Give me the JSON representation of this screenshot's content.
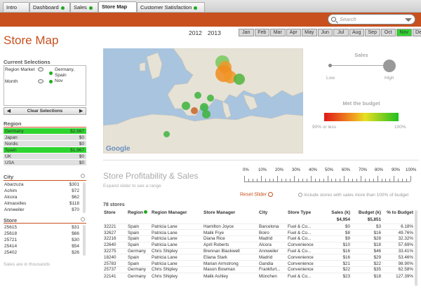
{
  "tabs": [
    {
      "label": "Intro",
      "dot": false,
      "active": false
    },
    {
      "label": "Dashboard",
      "dot": true,
      "active": false
    },
    {
      "label": "Sales",
      "dot": true,
      "active": false
    },
    {
      "label": "Store Map",
      "dot": false,
      "active": true
    },
    {
      "label": "Customer Satisfaction",
      "dot": true,
      "active": false
    }
  ],
  "search": {
    "placeholder": "Search"
  },
  "page_title": "Store Map",
  "years": [
    "2012",
    "2013"
  ],
  "months": [
    "Jan",
    "Feb",
    "Mar",
    "Apr",
    "May",
    "Jun",
    "Jul",
    "Aug",
    "Sep",
    "Oct",
    "Nov",
    "Dec"
  ],
  "selected_month": "Nov",
  "current_selections": {
    "title": "Current Selections",
    "rows": [
      {
        "field": "Region Market",
        "value": "Germany, Spain"
      },
      {
        "field": "Month",
        "value": "Nov"
      }
    ],
    "clear_label": "Clear Selections"
  },
  "region": {
    "title": "Region",
    "rows": [
      {
        "name": "Germany",
        "value": "$2,987",
        "selected": true
      },
      {
        "name": "Japan",
        "value": "$0",
        "selected": false
      },
      {
        "name": "Nordic",
        "value": "$0",
        "selected": false
      },
      {
        "name": "Spain",
        "value": "$1,967",
        "selected": true
      },
      {
        "name": "UK",
        "value": "$0",
        "selected": false
      },
      {
        "name": "USA",
        "value": "$0",
        "selected": false
      }
    ]
  },
  "city": {
    "title": "City",
    "rows": [
      {
        "name": "Abarzuza",
        "value": "$301"
      },
      {
        "name": "Achim",
        "value": "$72"
      },
      {
        "name": "Alcora",
        "value": "$62"
      },
      {
        "name": "Almacelles",
        "value": "$118"
      },
      {
        "name": "Annweiler",
        "value": "$70"
      }
    ]
  },
  "store_list": {
    "title": "Store",
    "rows": [
      {
        "name": "25615",
        "value": "$31"
      },
      {
        "name": "25618",
        "value": "$66"
      },
      {
        "name": "25721",
        "value": "$30"
      },
      {
        "name": "25414",
        "value": "$54"
      },
      {
        "name": "25402",
        "value": "$26"
      }
    ]
  },
  "footnote": "Sales are in thousands",
  "sales_widget": {
    "title": "Sales",
    "low": "Low",
    "high": "High"
  },
  "budget_widget": {
    "title": "Met the budget",
    "left": "90% or less",
    "right": "100%"
  },
  "map": {
    "provider": "Google"
  },
  "profitability": {
    "title": "Store Profitability & Sales",
    "hint": "Expand slider to see a range",
    "slider_labels": [
      "0%",
      "10%",
      "20%",
      "30%",
      "40%",
      "50%",
      "60%",
      "70%",
      "80%",
      "90%",
      "100%"
    ],
    "reset_label": "Reset Slider",
    "include_label": "Include stores with sales more than 100% of budget"
  },
  "table": {
    "count": "78 stores",
    "headers": [
      "Store",
      "Region",
      "Region Manager",
      "Store Manager",
      "City",
      "Store Type",
      "Sales (k)",
      "Budget (k)",
      "% to Budget"
    ],
    "totals": [
      "",
      "",
      "",
      "",
      "",
      "",
      "$4,954",
      "$5,851",
      ""
    ],
    "rows": [
      [
        "32221",
        "Spain",
        "Patricia Lane",
        "Hamilton Joyce",
        "Barcelona",
        "Fuel & Co...",
        "$0",
        "$3",
        "6.18%"
      ],
      [
        "32627",
        "Spain",
        "Patricia Lane",
        "Malik Frye",
        "Boiro",
        "Fuel & Co...",
        "$8",
        "$16",
        "49.76%"
      ],
      [
        "32216",
        "Spain",
        "Patricia Lane",
        "Diana Rice",
        "Madrid",
        "Fuel & Co...",
        "$9",
        "$28",
        "32.32%"
      ],
      [
        "22640",
        "Spain",
        "Patricia Lane",
        "April Roberts",
        "Alcora",
        "Convenience",
        "$10",
        "$18",
        "57.69%"
      ],
      [
        "32275",
        "Germany",
        "Chris Shipley",
        "Brennan Blackwell",
        "Annweiler",
        "Fuel & Co...",
        "$16",
        "$46",
        "33.41%"
      ],
      [
        "18240",
        "Spain",
        "Patricia Lane",
        "Eliana Stark",
        "Madrid",
        "Convenience",
        "$16",
        "$29",
        "53.46%"
      ],
      [
        "25783",
        "Spain",
        "Patricia Lane",
        "Marian Armstrong",
        "Gandia",
        "Convenience",
        "$21",
        "$22",
        "98.90%"
      ],
      [
        "25737",
        "Germany",
        "Chris Shipley",
        "Mason Bowman",
        "Frankfurt...",
        "Convenience",
        "$22",
        "$35",
        "62.58%"
      ],
      [
        "22141",
        "Germany",
        "Chris Shipley",
        "Malik Ashley",
        "München",
        "Fuel & Co...",
        "$23",
        "$18",
        "127.39%"
      ]
    ]
  },
  "colors": {
    "brand": "#c8501e",
    "selected": "#2fd52f",
    "status_dot": "#1faa1f"
  }
}
